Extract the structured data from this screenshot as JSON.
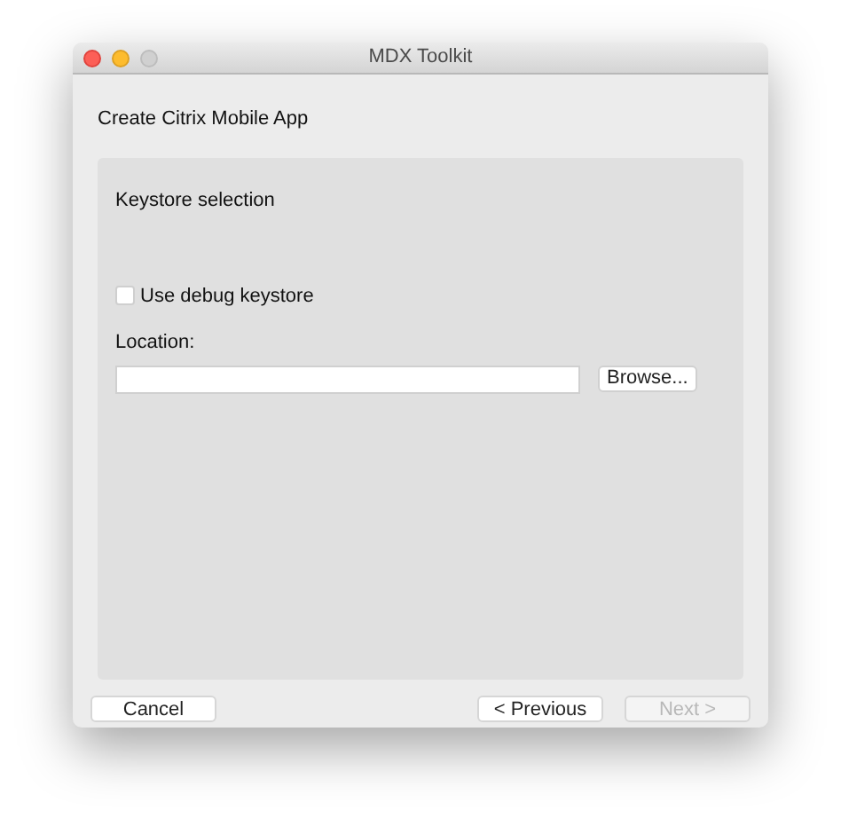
{
  "window": {
    "title": "MDX Toolkit"
  },
  "heading": "Create Citrix Mobile App",
  "panel": {
    "title": "Keystore selection",
    "checkbox": {
      "label": "Use debug keystore",
      "checked": false
    },
    "location": {
      "label": "Location:"
    },
    "browse_button": "Browse..."
  },
  "left_buttons": [
    {
      "label": "Cancel",
      "disabled": false
    }
  ],
  "right_buttons": [
    {
      "label": "< Previous",
      "disabled": false
    },
    {
      "label": "Next >",
      "disabled": true
    }
  ]
}
